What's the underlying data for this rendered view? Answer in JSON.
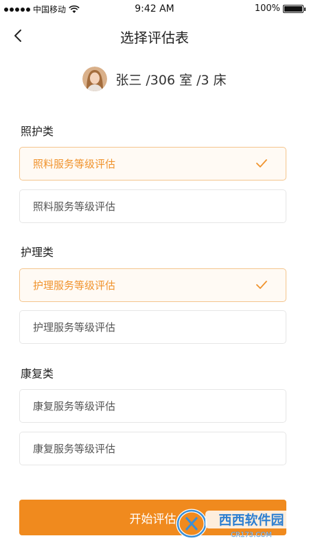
{
  "status_bar": {
    "carrier": "中国移动",
    "time": "9:42 AM",
    "battery": "100%"
  },
  "nav": {
    "title": "选择评估表",
    "back_icon": "chevron-left-icon"
  },
  "patient": {
    "info": "张三 /306 室 /3 床"
  },
  "sections": [
    {
      "label": "照护类",
      "options": [
        {
          "label": "照料服务等级评估",
          "selected": true
        },
        {
          "label": "照料服务等级评估",
          "selected": false
        }
      ]
    },
    {
      "label": "护理类",
      "options": [
        {
          "label": "护理服务等级评估",
          "selected": true
        },
        {
          "label": "护理服务等级评估",
          "selected": false
        }
      ]
    },
    {
      "label": "康复类",
      "options": [
        {
          "label": "康复服务等级评估",
          "selected": false
        },
        {
          "label": "康复服务等级评估",
          "selected": false
        }
      ]
    }
  ],
  "start_button": {
    "label": "开始评估"
  },
  "colors": {
    "accent": "#f08a1e",
    "selected_border": "#f4c48c",
    "selected_text": "#f0932d"
  },
  "watermark": {
    "brand": "西西软件园",
    "site": "CR173.COM"
  }
}
